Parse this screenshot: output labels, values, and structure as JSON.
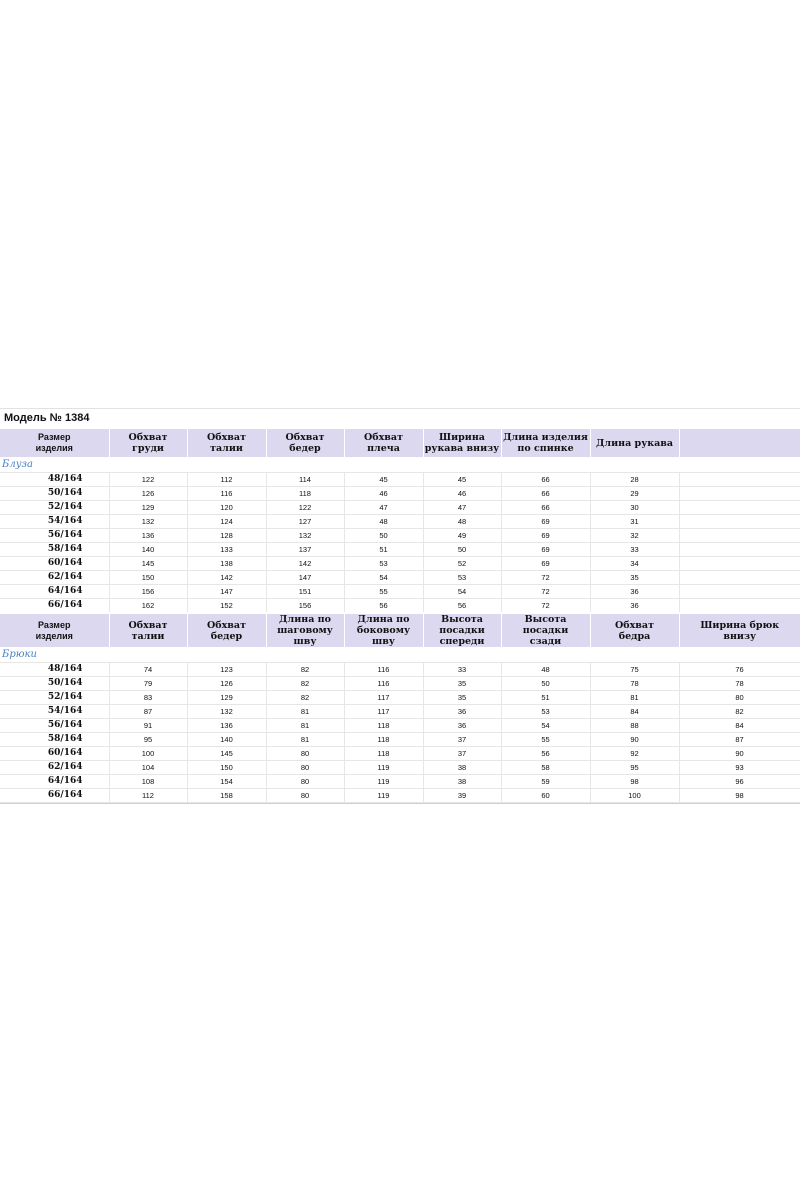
{
  "model_title": "Модель №  1384",
  "colors": {
    "header_bg": "#dcd8ef",
    "section_label": "#4a80c8"
  },
  "blouse": {
    "section_label": "Блуза",
    "headers": [
      [
        "Размер",
        "изделия"
      ],
      [
        "Обхват",
        "груди"
      ],
      [
        "Обхват",
        "талии"
      ],
      [
        "Обхват",
        "бедер"
      ],
      [
        "Обхват",
        "плеча"
      ],
      [
        "Ширина",
        "рукава внизу"
      ],
      [
        "Длина изделия",
        "по спинке"
      ],
      [
        "Длина рукава",
        ""
      ],
      [
        "",
        ""
      ]
    ],
    "rows": [
      [
        "48/164",
        "122",
        "112",
        "114",
        "45",
        "45",
        "66",
        "28",
        ""
      ],
      [
        "50/164",
        "126",
        "116",
        "118",
        "46",
        "46",
        "66",
        "29",
        ""
      ],
      [
        "52/164",
        "129",
        "120",
        "122",
        "47",
        "47",
        "66",
        "30",
        ""
      ],
      [
        "54/164",
        "132",
        "124",
        "127",
        "48",
        "48",
        "69",
        "31",
        ""
      ],
      [
        "56/164",
        "136",
        "128",
        "132",
        "50",
        "49",
        "69",
        "32",
        ""
      ],
      [
        "58/164",
        "140",
        "133",
        "137",
        "51",
        "50",
        "69",
        "33",
        ""
      ],
      [
        "60/164",
        "145",
        "138",
        "142",
        "53",
        "52",
        "69",
        "34",
        ""
      ],
      [
        "62/164",
        "150",
        "142",
        "147",
        "54",
        "53",
        "72",
        "35",
        ""
      ],
      [
        "64/164",
        "156",
        "147",
        "151",
        "55",
        "54",
        "72",
        "36",
        ""
      ],
      [
        "66/164",
        "162",
        "152",
        "156",
        "56",
        "56",
        "72",
        "36",
        ""
      ]
    ]
  },
  "trousers": {
    "section_label": "Брюки",
    "headers": [
      [
        "Размер",
        "изделия"
      ],
      [
        "Обхват",
        "талии"
      ],
      [
        "Обхват",
        "бедер"
      ],
      [
        "Длина по",
        "шаговому шву"
      ],
      [
        "Длина по",
        "боковому шву"
      ],
      [
        "Высота посадки",
        "спереди"
      ],
      [
        "Высота посадки",
        "сзади"
      ],
      [
        "Обхват",
        "бедра"
      ],
      [
        "Ширина брюк",
        "внизу"
      ]
    ],
    "rows": [
      [
        "48/164",
        "74",
        "123",
        "82",
        "116",
        "33",
        "48",
        "75",
        "76"
      ],
      [
        "50/164",
        "79",
        "126",
        "82",
        "116",
        "35",
        "50",
        "78",
        "78"
      ],
      [
        "52/164",
        "83",
        "129",
        "82",
        "117",
        "35",
        "51",
        "81",
        "80"
      ],
      [
        "54/164",
        "87",
        "132",
        "81",
        "117",
        "36",
        "53",
        "84",
        "82"
      ],
      [
        "56/164",
        "91",
        "136",
        "81",
        "118",
        "36",
        "54",
        "88",
        "84"
      ],
      [
        "58/164",
        "95",
        "140",
        "81",
        "118",
        "37",
        "55",
        "90",
        "87"
      ],
      [
        "60/164",
        "100",
        "145",
        "80",
        "118",
        "37",
        "56",
        "92",
        "90"
      ],
      [
        "62/164",
        "104",
        "150",
        "80",
        "119",
        "38",
        "58",
        "95",
        "93"
      ],
      [
        "64/164",
        "108",
        "154",
        "80",
        "119",
        "38",
        "59",
        "98",
        "96"
      ],
      [
        "66/164",
        "112",
        "158",
        "80",
        "119",
        "39",
        "60",
        "100",
        "98"
      ]
    ]
  }
}
